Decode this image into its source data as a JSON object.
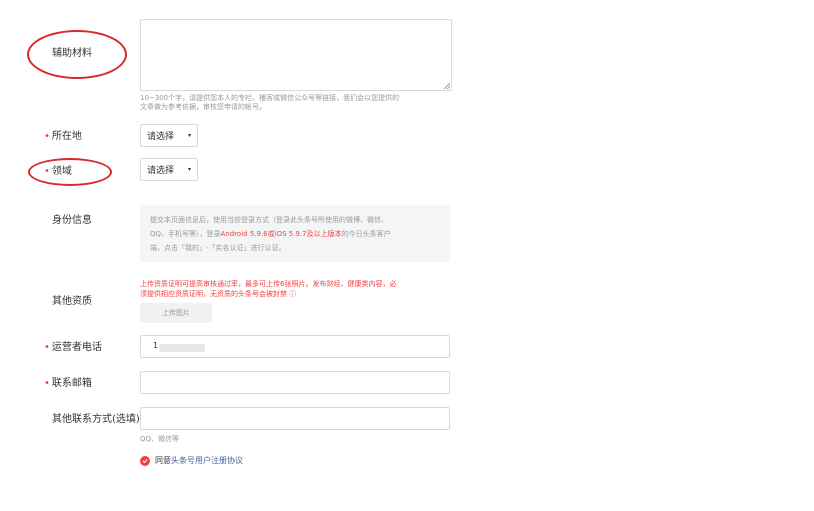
{
  "fields": {
    "materials": {
      "label": "辅助材料",
      "hint_line1": "10~300个字，请提供您本人的专栏、播客或微信公众号等链接，我们会以您提供的",
      "hint_line2": "文章做为参考依据，审核您申请的帐号。"
    },
    "location": {
      "required_mark": "•",
      "label": "所在地",
      "select_value": "请选择",
      "caret": "▾"
    },
    "domain": {
      "required_mark": "•",
      "label": "领域",
      "select_value": "请选择",
      "caret": "▾"
    },
    "identity": {
      "label": "身份信息",
      "text_line1": "提交本页面信息后，使用当前登录方式（登录此头条号所使用的微博、微信、",
      "text_line2_pre": "QQ、手机号等），登录",
      "text_line2_red": "Android 5.9.6或iOS 5.9.7及以上版本",
      "text_line2_post": "的今日头条客户",
      "text_line3": "端，点击「我的」-「实名认证」进行认证。"
    },
    "other_qualifications": {
      "label": "其他资质",
      "warning_line1": "上传资质证明可提高审核通过率，最多可上传6张照片。发布财经、健康类内容，必",
      "warning_line2": "须提供相应资质证明，无资质的头条号会被封禁 ⓘ",
      "upload_label": "上传图片"
    },
    "operator_phone": {
      "required_mark": "•",
      "label": "运营者电话",
      "value": "1"
    },
    "contact_email": {
      "required_mark": "•",
      "label": "联系邮箱",
      "value": ""
    },
    "other_contact": {
      "label": "其他联系方式(选填)",
      "hint": "QQ、微信等",
      "value": ""
    }
  },
  "agreement": {
    "prefix": "同意",
    "link": "头条号用户注册协议"
  },
  "colors": {
    "required": "#f04142",
    "link": "#406599",
    "annotation_circle": "#d82a2a"
  }
}
